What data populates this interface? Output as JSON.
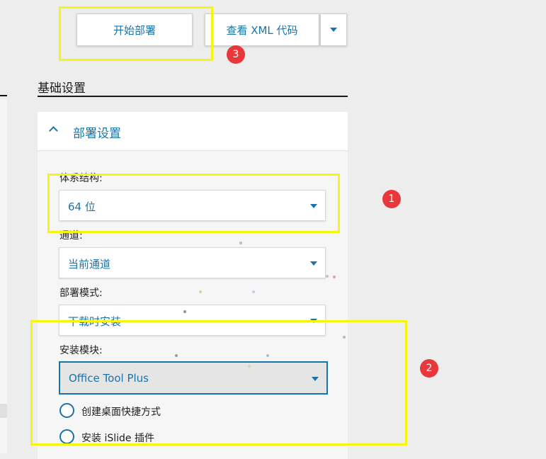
{
  "toolbar": {
    "start_label": "开始部署",
    "xml_label": "查看 XML 代码",
    "dropdown_icon": "caret-down-icon"
  },
  "section": {
    "title": "基础设置"
  },
  "panel": {
    "title": "部署设置",
    "collapse_icon": "chevron-up-icon"
  },
  "fields": {
    "architecture": {
      "label": "体系结构:",
      "value": "64 位"
    },
    "channel": {
      "label": "通道:",
      "value": "当前通道"
    },
    "deploy_mode": {
      "label": "部署模式:",
      "value": "下载时安装"
    },
    "install_module": {
      "label": "安装模块:",
      "value": "Office Tool Plus"
    }
  },
  "options": [
    {
      "label": "创建桌面快捷方式"
    },
    {
      "label": "安装 iSlide 插件"
    }
  ],
  "annotations": {
    "badge_1": "1",
    "badge_2": "2",
    "badge_3": "3",
    "highlight_color": "#f5f512",
    "badge_color": "#e8383b"
  },
  "colors": {
    "accent": "#1a73a8",
    "background": "#ededed"
  }
}
